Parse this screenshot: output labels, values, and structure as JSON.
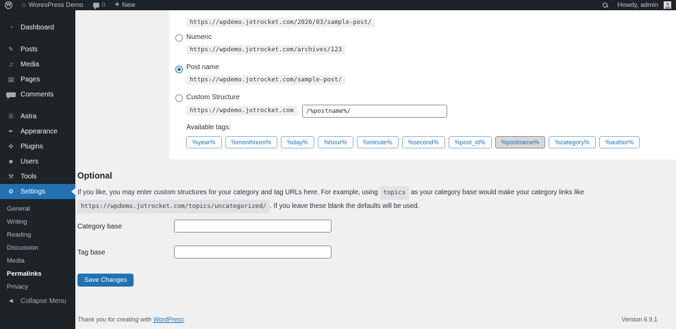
{
  "colors": {
    "accent": "#2271b1",
    "admin_bar_bg": "#1d2327",
    "sidebar_bg": "#1d2327",
    "content_bg": "#f0f0f1",
    "panel_bg": "#ffffff",
    "code_bg": "#f0f0f1",
    "active_tag_bg": "#d9d9db",
    "link": "#2271b1"
  },
  "admin_bar": {
    "site_name": "WoresPress Demo",
    "comments_count": "0",
    "plus": "+",
    "new_label": "New",
    "howdy": "Howdy, admin"
  },
  "sidebar": {
    "items": [
      {
        "item_name": "sidebar-item-dashboard",
        "icon_name": "dashboard-icon",
        "icon": "◔",
        "label": "Dashboard"
      },
      {
        "item_name": "sidebar-item-posts",
        "icon_name": "posts-icon",
        "icon": "✎",
        "label": "Posts",
        "gap": true
      },
      {
        "item_name": "sidebar-item-media",
        "icon_name": "media-icon",
        "icon": "♫",
        "label": "Media"
      },
      {
        "item_name": "sidebar-item-pages",
        "icon_name": "pages-icon",
        "icon": "▤",
        "label": "Pages"
      },
      {
        "item_name": "sidebar-item-comments",
        "icon_name": "comments-icon",
        "icon": "",
        "icon_class": "bubble",
        "label": "Comments"
      },
      {
        "item_name": "sidebar-item-astra",
        "icon_name": "astra-icon",
        "icon": "Ⓐ",
        "label": "Astra",
        "gap": true
      },
      {
        "item_name": "sidebar-item-appearance",
        "icon_name": "appearance-icon",
        "icon": "✒",
        "label": "Appearance"
      },
      {
        "item_name": "sidebar-item-plugins",
        "icon_name": "plugins-icon",
        "icon": "✜",
        "label": "Plugins"
      },
      {
        "item_name": "sidebar-item-users",
        "icon_name": "users-icon",
        "icon": "☻",
        "label": "Users"
      },
      {
        "item_name": "sidebar-item-tools",
        "icon_name": "tools-icon",
        "icon": "⚒",
        "label": "Tools"
      }
    ],
    "settings_label": "Settings",
    "settings_icon": "⚙",
    "submenu": [
      {
        "item_name": "submenu-item-general",
        "label": "General"
      },
      {
        "item_name": "submenu-item-writing",
        "label": "Writing"
      },
      {
        "item_name": "submenu-item-reading",
        "label": "Reading"
      },
      {
        "item_name": "submenu-item-discussion",
        "label": "Discussion"
      },
      {
        "item_name": "submenu-item-media",
        "label": "Media"
      },
      {
        "item_name": "submenu-item-permalinks",
        "label": "Permalinks",
        "active": true
      },
      {
        "item_name": "submenu-item-privacy",
        "label": "Privacy"
      }
    ],
    "collapse_icon": "◀",
    "collapse_label": "Collapse Menu"
  },
  "permalinks": {
    "month_name_url": "https://wpdemo.jotrocket.com/2026/03/sample-post/",
    "numeric_label": "Numeric",
    "numeric_url": "https://wpdemo.jotrocket.com/archives/123",
    "postname_label": "Post name",
    "postname_url": "https://wpdemo.jotrocket.com/sample-post/",
    "custom_label": "Custom Structure",
    "custom_prefix": "https://wpdemo.jotrocket.com",
    "custom_value": "/%postname%/",
    "available_tags_label": "Available tags:",
    "tags": [
      {
        "name": "tag-button-year",
        "label": "%year%"
      },
      {
        "name": "tag-button-monthnum",
        "label": "%monthnum%"
      },
      {
        "name": "tag-button-day",
        "label": "%day%"
      },
      {
        "name": "tag-button-hour",
        "label": "%hour%"
      },
      {
        "name": "tag-button-minute",
        "label": "%minute%"
      },
      {
        "name": "tag-button-second",
        "label": "%second%"
      },
      {
        "name": "tag-button-post-id",
        "label": "%post_id%"
      },
      {
        "name": "tag-button-postname",
        "label": "%postname%",
        "active": true
      },
      {
        "name": "tag-button-category",
        "label": "%category%"
      },
      {
        "name": "tag-button-author",
        "label": "%author%"
      }
    ]
  },
  "optional": {
    "heading": "Optional",
    "p1": "If you like, you may enter custom structures for your category and tag URLs here. For example, using ",
    "code1": "topics",
    "p2": " as your category base would make your category links like",
    "code2": "https://wpdemo.jotrocket.com/topics/uncategorized/",
    "p3": ". If you leave these blank the defaults will be used."
  },
  "fields": {
    "category_label": "Category base",
    "category_value": "",
    "tag_label": "Tag base",
    "tag_value": ""
  },
  "save_label": "Save Changes",
  "footer": {
    "thanks": "Thank you for creating with ",
    "link_label": "WordPress",
    "period": ".",
    "version": "Version 6.9.1"
  }
}
